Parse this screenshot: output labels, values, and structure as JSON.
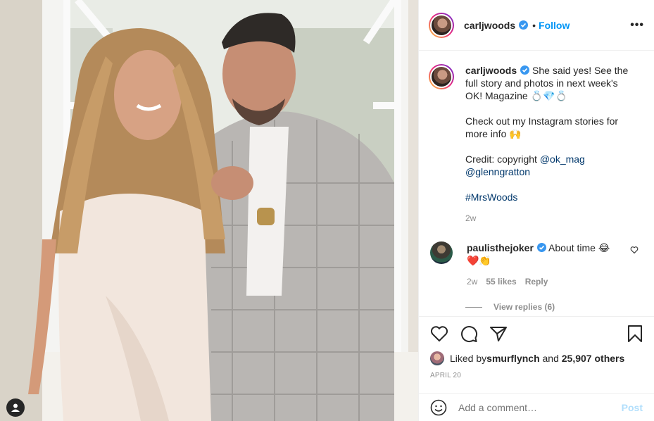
{
  "post": {
    "username": "carljwoods",
    "follow_label": "Follow",
    "more_label": "•••",
    "dot": "•"
  },
  "caption": {
    "username": "carljwoods",
    "line1": "She said yes! See the full story and photos in next week's OK! Magazine 💍💎💍",
    "line2": "Check out my Instagram stories for more info 🙌",
    "credit_prefix": "Credit: copyright ",
    "credit_mention1": "@ok_mag",
    "credit_mention2": "@glenngratton",
    "hashtag": "#MrsWoods",
    "time": "2w"
  },
  "comment": {
    "username": "paulisthejoker",
    "text": "About time 😂",
    "text2": "❤️👏",
    "time": "2w",
    "likes": "55 likes",
    "reply_label": "Reply",
    "view_replies": "View replies (6)"
  },
  "likes": {
    "prefix": "Liked by ",
    "user": "smurflynch",
    "middle": " and ",
    "count": "25,907 others"
  },
  "date": "APRIL 20",
  "add_comment": {
    "placeholder": "Add a comment…",
    "post_label": "Post"
  },
  "colors": {
    "accent": "#0095f6",
    "link": "#00376b",
    "muted": "#8e8e8e",
    "post_disabled": "#b2dffc"
  }
}
